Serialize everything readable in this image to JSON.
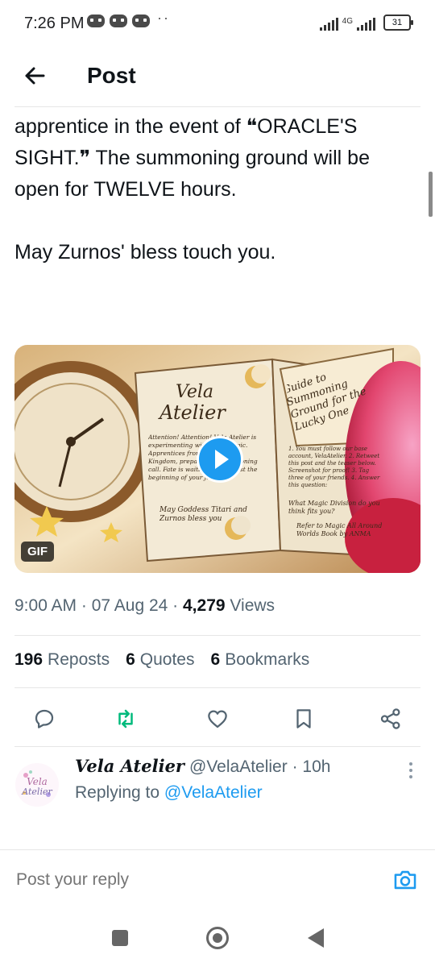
{
  "status_bar": {
    "time": "7:26 PM",
    "network": "4G",
    "battery": "31"
  },
  "header": {
    "title": "Post",
    "back_icon": "arrow-left-icon"
  },
  "post": {
    "text_lines": [
      "apprentice in the event of ❝ORACLE'S",
      "SIGHT.❞ The summoning ground will be",
      "open for TWELVE hours."
    ],
    "text_line_2": "May Zurnos' bless touch you.",
    "media": {
      "badge": "GIF",
      "book_title_1": "Vela",
      "book_title_2": "Atelier",
      "scroll_text": "Guide to Summoning Ground for the Lucky One",
      "left_page": "Attention! Attention! Vela Atelier is experimenting with their Magic. Apprentices from all over the Kingdom, prepare for a summoning call. Fate is waiting! This is just the beginning of your journey.",
      "left_sign": "May Goddess Titari and Zurnos bless you",
      "right_page": "1. You must follow our base account, VelaAtelier. 2. Retweet this post and the teaser below. Screenshot for proof! 3. Tag three of your friends. 4. Answer this question:",
      "right_question": "What Magic Division do you think fits you?",
      "right_footer": "Refer to Magic All Around Worlds Book by ANMA"
    },
    "time": "9:00 AM",
    "date": "07 Aug 24",
    "views_count": "4,279",
    "views_label": "Views",
    "reposts_count": "196",
    "reposts_label": "Reposts",
    "quotes_count": "6",
    "quotes_label": "Quotes",
    "bookmarks_count": "6",
    "bookmarks_label": "Bookmarks"
  },
  "actions": {
    "reply_icon": "reply-icon",
    "repost_icon": "repost-icon",
    "like_icon": "heart-icon",
    "bookmark_icon": "bookmark-icon",
    "share_icon": "share-icon",
    "repost_color": "#00ba7c"
  },
  "reply": {
    "display_name": "Vela Atelier",
    "handle": "@VelaAtelier",
    "time": "10h",
    "replying_label": "Replying to",
    "replying_mention": "@VelaAtelier"
  },
  "compose": {
    "placeholder": "Post your reply",
    "camera_icon": "camera-icon"
  },
  "colors": {
    "accent": "#1d9bf0",
    "text_primary": "#0f1419",
    "text_secondary": "#536471"
  }
}
